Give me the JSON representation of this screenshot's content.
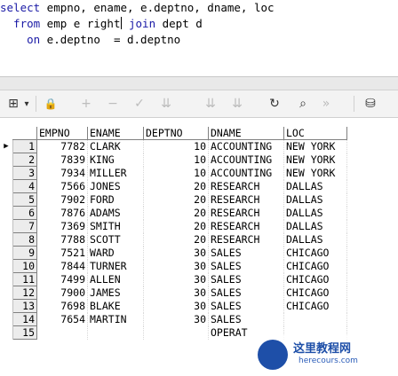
{
  "editor": {
    "line1": [
      "select",
      " empno, ename, e.deptno, dname, loc"
    ],
    "line2": [
      "  from",
      " emp e right",
      " join",
      " dept d"
    ],
    "line3": [
      "    on",
      " e.deptno  = d.deptno"
    ]
  },
  "toolbar": {
    "grid_icon": "grid-icon",
    "dropdown_icon": "chevron-down-icon",
    "lock_icon": "lock-icon",
    "refresh_icon": "refresh-icon",
    "find_icon": "binoculars-icon",
    "connect_icon": "database-icon",
    "grid_glyph": "⊞",
    "dropdown_glyph": "▾",
    "lock_glyph": "🔒",
    "refresh_glyph": "↻",
    "find_glyph": "⌕",
    "connect_glyph": "⛁"
  },
  "grid": {
    "columns": [
      "EMPNO",
      "ENAME",
      "DEPTNO",
      "DNAME",
      "LOC"
    ],
    "rows": [
      {
        "n": "1",
        "empno": "7782",
        "ename": "CLARK",
        "deptno": "10",
        "dname": "ACCOUNTING",
        "loc": "NEW YORK"
      },
      {
        "n": "2",
        "empno": "7839",
        "ename": "KING",
        "deptno": "10",
        "dname": "ACCOUNTING",
        "loc": "NEW YORK"
      },
      {
        "n": "3",
        "empno": "7934",
        "ename": "MILLER",
        "deptno": "10",
        "dname": "ACCOUNTING",
        "loc": "NEW YORK"
      },
      {
        "n": "4",
        "empno": "7566",
        "ename": "JONES",
        "deptno": "20",
        "dname": "RESEARCH",
        "loc": "DALLAS"
      },
      {
        "n": "5",
        "empno": "7902",
        "ename": "FORD",
        "deptno": "20",
        "dname": "RESEARCH",
        "loc": "DALLAS"
      },
      {
        "n": "6",
        "empno": "7876",
        "ename": "ADAMS",
        "deptno": "20",
        "dname": "RESEARCH",
        "loc": "DALLAS"
      },
      {
        "n": "7",
        "empno": "7369",
        "ename": "SMITH",
        "deptno": "20",
        "dname": "RESEARCH",
        "loc": "DALLAS"
      },
      {
        "n": "8",
        "empno": "7788",
        "ename": "SCOTT",
        "deptno": "20",
        "dname": "RESEARCH",
        "loc": "DALLAS"
      },
      {
        "n": "9",
        "empno": "7521",
        "ename": "WARD",
        "deptno": "30",
        "dname": "SALES",
        "loc": "CHICAGO"
      },
      {
        "n": "10",
        "empno": "7844",
        "ename": "TURNER",
        "deptno": "30",
        "dname": "SALES",
        "loc": "CHICAGO"
      },
      {
        "n": "11",
        "empno": "7499",
        "ename": "ALLEN",
        "deptno": "30",
        "dname": "SALES",
        "loc": "CHICAGO"
      },
      {
        "n": "12",
        "empno": "7900",
        "ename": "JAMES",
        "deptno": "30",
        "dname": "SALES",
        "loc": "CHICAGO"
      },
      {
        "n": "13",
        "empno": "7698",
        "ename": "BLAKE",
        "deptno": "30",
        "dname": "SALES",
        "loc": "CHICAGO"
      },
      {
        "n": "14",
        "empno": "7654",
        "ename": "MARTIN",
        "deptno": "30",
        "dname": "SALES",
        "loc": ""
      },
      {
        "n": "15",
        "empno": "",
        "ename": "",
        "deptno": "",
        "dname": "OPERAT",
        "loc": ""
      }
    ],
    "current_row_marker": "▶"
  },
  "watermark": {
    "title": "这里教程网",
    "subtitle": "herecours.com"
  },
  "colors": {
    "keyword": "#1a1aa6",
    "watermark": "#1e4fa8"
  }
}
